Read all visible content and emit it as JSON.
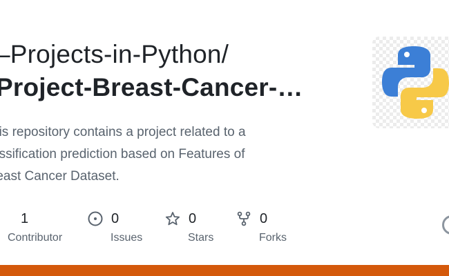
{
  "repo": {
    "owner_line": "–Projects-in-Python/",
    "name_line": "Project-Breast-Cancer-…",
    "description_lines": [
      "his repository contains a project related to a",
      "assification prediction based on Features of",
      "reast Cancer Dataset."
    ]
  },
  "stats": {
    "contributors": {
      "count": "1",
      "label": "Contributor",
      "icon": "people-icon"
    },
    "issues": {
      "count": "0",
      "label": "Issues",
      "icon": "issue-opened-icon"
    },
    "stars": {
      "count": "0",
      "label": "Stars",
      "icon": "star-icon"
    },
    "forks": {
      "count": "0",
      "label": "Forks",
      "icon": "fork-icon"
    }
  },
  "logo": {
    "icon": "python-logo"
  },
  "colors": {
    "accent_bar": "#d4590b",
    "python_blue": "#3c7fd6",
    "python_yellow": "#f7c948",
    "text_primary": "#1f2328",
    "text_muted": "#59636e"
  }
}
